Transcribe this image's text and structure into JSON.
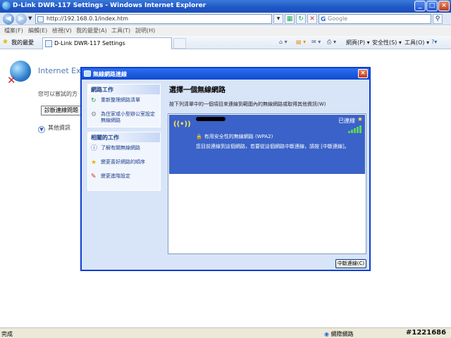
{
  "browser": {
    "title": "D-Link DWR-117 Settings - Windows Internet Explorer",
    "address": "http://192.168.0.1/index.htm",
    "search_placeholder": "Google",
    "menu": [
      "檔案(F)",
      "編輯(E)",
      "檢視(V)",
      "我的最愛(A)",
      "工具(T)",
      "說明(H)"
    ],
    "favorites_label": "我的最愛",
    "tab_title": "D-Link DWR-117 Settings",
    "right_tools": [
      "網頁(P) ▾",
      "安全性(S) ▾",
      "工具(O) ▾"
    ]
  },
  "page": {
    "heading": "Internet Explorer 無法顯示網頁",
    "description": "您可以嘗試的方",
    "diagnose_button": "診斷連線問題",
    "more_info": "其他資訊"
  },
  "dialog": {
    "title": "無線網路連線",
    "network_tasks_header": "網路工作",
    "network_tasks": [
      "重新整理網路清單",
      "為住家或小型辦公室設定無線網路"
    ],
    "related_tasks_header": "相關的工作",
    "related_tasks": [
      "了解有關無線網路",
      "變更喜好網路的順序",
      "變更進階設定"
    ],
    "panel_title": "選擇一個無線網路",
    "panel_desc": "按下列清單中的一個項目來連線到範圍內的無線網路或取得其他資訊(W)",
    "network": {
      "status": "已連線",
      "security": "有用安全性的無線網路 (WPA2)",
      "message": "您目前連線到這個網路，若要從這個網路中斷連線，請按 [中斷連線]。"
    },
    "disconnect_button": "中斷連線(C)"
  },
  "statusbar": {
    "left": "完成",
    "zone": "網際網路",
    "watermark": "#1221686"
  }
}
